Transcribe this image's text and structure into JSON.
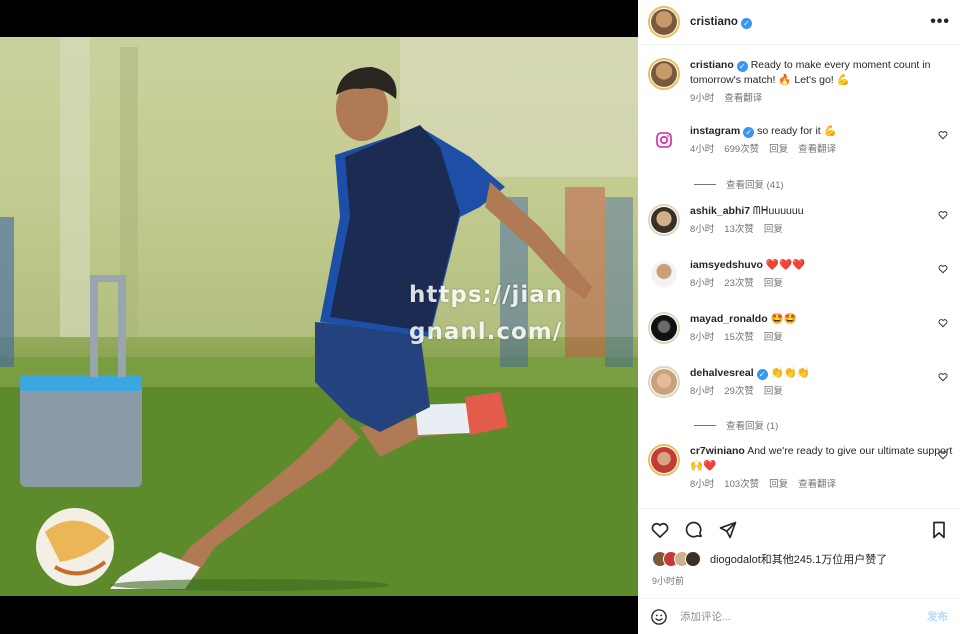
{
  "header": {
    "username": "cristiano",
    "more_icon": "more-horizontal-icon"
  },
  "watermark": "https://jiangnanl.com/",
  "caption": {
    "username": "cristiano",
    "text": "Ready to make every moment count in tomorrow's match! 🔥 Let's go! 💪",
    "time": "9小时",
    "translate": "查看翻译"
  },
  "comments": [
    {
      "username": "instagram",
      "verified": true,
      "text": "so ready for it 💪",
      "time": "4小时",
      "likes": "699次赞",
      "reply": "回复",
      "translate": "查看翻译",
      "view_replies": "查看回复 (41)"
    },
    {
      "username": "ashik_abhi7",
      "verified": false,
      "text": "ᗰᕼuuuuuu",
      "time": "8小时",
      "likes": "13次赞",
      "reply": "回复"
    },
    {
      "username": "iamsyedshuvo",
      "verified": false,
      "text": "❤️❤️❤️",
      "time": "8小时",
      "likes": "23次赞",
      "reply": "回复"
    },
    {
      "username": "mayad_ronaldo",
      "verified": false,
      "text": "🤩🤩",
      "time": "8小时",
      "likes": "15次赞",
      "reply": "回复"
    },
    {
      "username": "dehalvesreal",
      "verified": true,
      "text": "👏👏👏",
      "time": "8小时",
      "likes": "29次赞",
      "reply": "回复",
      "view_replies": "查看回复 (1)"
    },
    {
      "username": "cr7winiano",
      "verified": false,
      "text": "And we're ready to give our ultimate support🙌❤️",
      "time": "8小时",
      "likes": "103次赞",
      "reply": "回复",
      "translate": "查看翻译"
    }
  ],
  "likes_text": "diogodalot和其他245.1万位用户赞了",
  "post_time": "9小时前",
  "comment_box": {
    "placeholder": "添加评论...",
    "post_label": "发布"
  },
  "colors": {
    "verified": "#3897f0",
    "story_ring": "#e8c060",
    "post_button": "#b3dbff"
  }
}
